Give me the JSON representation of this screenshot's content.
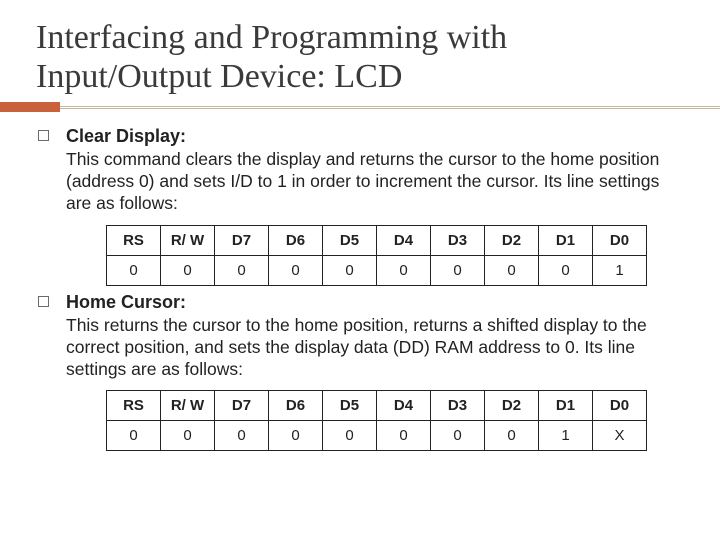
{
  "title": "Interfacing and Programming with Input/Output Device: LCD",
  "sections": [
    {
      "heading": "Clear Display:",
      "body": "This command clears the display and returns the cursor to the home position (address 0) and sets I/D to 1 in order to increment the cursor. Its line settings are as follows:",
      "table": {
        "headers": [
          "RS",
          "R/\nW",
          "D7",
          "D6",
          "D5",
          "D4",
          "D3",
          "D2",
          "D1",
          "D0"
        ],
        "row": [
          "0",
          "0",
          "0",
          "0",
          "0",
          "0",
          "0",
          "0",
          "0",
          "1"
        ]
      }
    },
    {
      "heading": "Home Cursor:",
      "body": "This returns the cursor to the home position, returns a shifted display to the correct position, and sets the display data (DD) RAM address to 0. Its line settings are as follows:",
      "table": {
        "headers": [
          "RS",
          "R/\nW",
          "D7",
          "D6",
          "D5",
          "D4",
          "D3",
          "D2",
          "D1",
          "D0"
        ],
        "row": [
          "0",
          "0",
          "0",
          "0",
          "0",
          "0",
          "0",
          "0",
          "1",
          "X"
        ]
      }
    }
  ],
  "chart_data": [
    {
      "type": "table",
      "title": "Clear Display line settings",
      "columns": [
        "RS",
        "R/W",
        "D7",
        "D6",
        "D5",
        "D4",
        "D3",
        "D2",
        "D1",
        "D0"
      ],
      "rows": [
        [
          "0",
          "0",
          "0",
          "0",
          "0",
          "0",
          "0",
          "0",
          "0",
          "1"
        ]
      ]
    },
    {
      "type": "table",
      "title": "Home Cursor line settings",
      "columns": [
        "RS",
        "R/W",
        "D7",
        "D6",
        "D5",
        "D4",
        "D3",
        "D2",
        "D1",
        "D0"
      ],
      "rows": [
        [
          "0",
          "0",
          "0",
          "0",
          "0",
          "0",
          "0",
          "0",
          "1",
          "X"
        ]
      ]
    }
  ]
}
